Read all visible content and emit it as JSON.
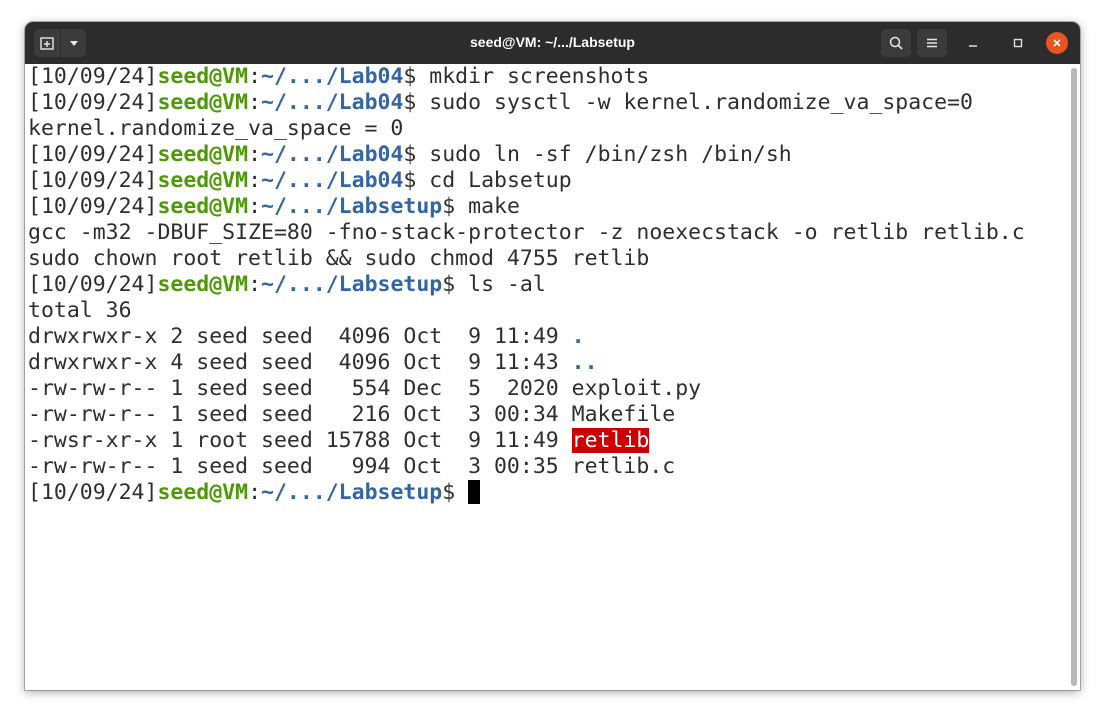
{
  "window": {
    "title": "seed@VM: ~/.../Labsetup"
  },
  "titlebar": {
    "new_tab_icon": "new-tab-icon",
    "tab_menu_icon": "chevron-down-icon",
    "search_icon": "search-icon",
    "menu_icon": "hamburger-menu-icon",
    "minimize_icon": "minimize-icon",
    "maximize_icon": "maximize-icon",
    "close_icon": "close-icon"
  },
  "colors": {
    "prompt_user": "#4e9a06",
    "prompt_path": "#3465a4",
    "suid_highlight": "#cc0000",
    "close_button": "#e95420"
  },
  "terminal": {
    "lines": [
      {
        "date": "[10/09/24]",
        "user": "seed@VM",
        "sep": ":",
        "path": "~/.../Lab04",
        "dollar": "$ ",
        "cmd": "mkdir screenshots"
      },
      {
        "date": "[10/09/24]",
        "user": "seed@VM",
        "sep": ":",
        "path": "~/.../Lab04",
        "dollar": "$ ",
        "cmd": "sudo sysctl -w kernel.randomize_va_space=0"
      },
      {
        "text": "kernel.randomize_va_space = 0"
      },
      {
        "date": "[10/09/24]",
        "user": "seed@VM",
        "sep": ":",
        "path": "~/.../Lab04",
        "dollar": "$ ",
        "cmd": "sudo ln -sf /bin/zsh /bin/sh"
      },
      {
        "date": "[10/09/24]",
        "user": "seed@VM",
        "sep": ":",
        "path": "~/.../Lab04",
        "dollar": "$ ",
        "cmd": "cd Labsetup"
      },
      {
        "date": "[10/09/24]",
        "user": "seed@VM",
        "sep": ":",
        "path": "~/.../Labsetup",
        "dollar": "$ ",
        "cmd": "make"
      },
      {
        "text": "gcc -m32 -DBUF_SIZE=80 -fno-stack-protector -z noexecstack -o retlib retlib.c"
      },
      {
        "text": "sudo chown root retlib && sudo chmod 4755 retlib"
      },
      {
        "date": "[10/09/24]",
        "user": "seed@VM",
        "sep": ":",
        "path": "~/.../Labsetup",
        "dollar": "$ ",
        "cmd": "ls -al"
      },
      {
        "text": "total 36"
      },
      {
        "perm": "drwxrwxr-x 2 seed seed  4096 Oct  9 11:49 ",
        "name": ".",
        "kind": "dir"
      },
      {
        "perm": "drwxrwxr-x 4 seed seed  4096 Oct  9 11:43 ",
        "name": "..",
        "kind": "dir"
      },
      {
        "perm": "-rw-rw-r-- 1 seed seed   554 Dec  5  2020 ",
        "name": "exploit.py",
        "kind": "file"
      },
      {
        "perm": "-rw-rw-r-- 1 seed seed   216 Oct  3 00:34 ",
        "name": "Makefile",
        "kind": "file"
      },
      {
        "perm": "-rwsr-xr-x 1 root seed 15788 Oct  9 11:49 ",
        "name": "retlib",
        "kind": "suid"
      },
      {
        "perm": "-rw-rw-r-- 1 seed seed   994 Oct  3 00:35 ",
        "name": "retlib.c",
        "kind": "file"
      },
      {
        "date": "[10/09/24]",
        "user": "seed@VM",
        "sep": ":",
        "path": "~/.../Labsetup",
        "dollar": "$ ",
        "cmd": "",
        "cursor": true
      }
    ]
  }
}
